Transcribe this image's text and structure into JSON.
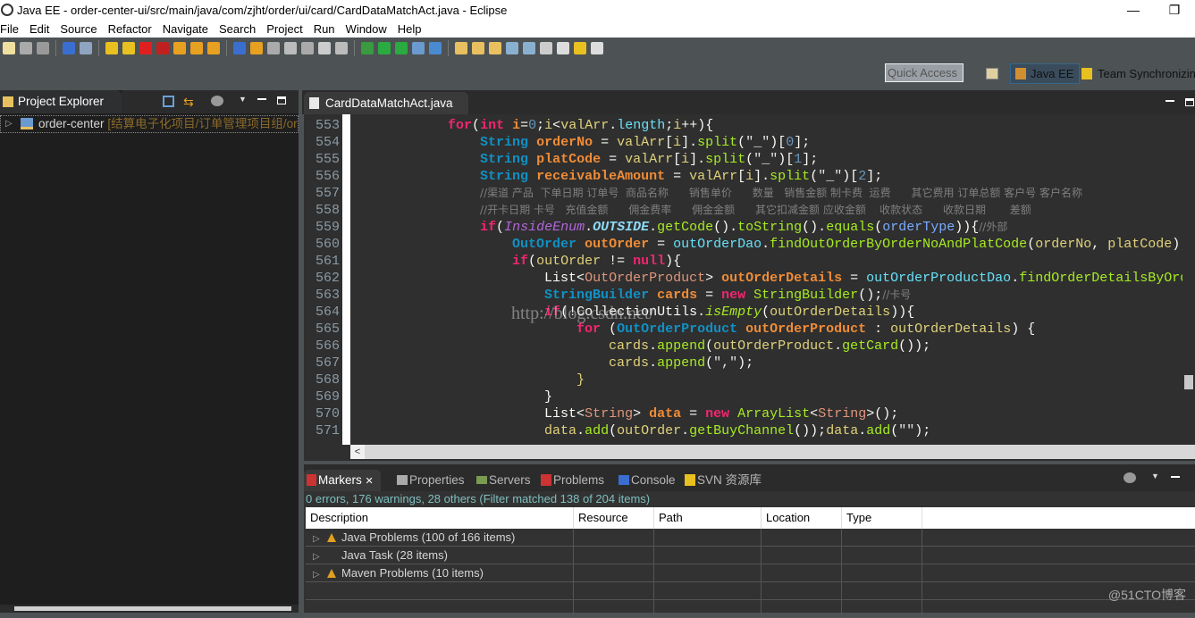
{
  "window": {
    "title": "Java EE - order-center-ui/src/main/java/com/zjht/order/ui/card/CardDataMatchAct.java - Eclipse",
    "minimize": "—",
    "restore": "❐"
  },
  "menu": [
    "File",
    "Edit",
    "Source",
    "Refactor",
    "Navigate",
    "Search",
    "Project",
    "Run",
    "Window",
    "Help"
  ],
  "toolbar": {
    "icons": [
      {
        "name": "new-icon",
        "color": "#f0e0a0"
      },
      {
        "name": "save-icon",
        "color": "#aaaaaa"
      },
      {
        "name": "save-all-icon",
        "color": "#999999"
      },
      {
        "name": "open-console-icon",
        "color": "#3a6fd0"
      },
      {
        "name": "skip-breakpoints-icon",
        "color": "#8fa4c0"
      },
      {
        "name": "resume-icon",
        "color": "#e8c020"
      },
      {
        "name": "suspend-icon",
        "color": "#e8c020"
      },
      {
        "name": "terminate-icon",
        "color": "#e02020"
      },
      {
        "name": "disconnect-icon",
        "color": "#c02020"
      },
      {
        "name": "step-into-icon",
        "color": "#e8a020"
      },
      {
        "name": "step-over-icon",
        "color": "#e8a020"
      },
      {
        "name": "step-return-icon",
        "color": "#e8a020"
      },
      {
        "name": "drop-to-frame-icon",
        "color": "#3a6fd0"
      },
      {
        "name": "use-step-filters-icon",
        "color": "#e8a020"
      },
      {
        "name": "tcp-monitor-icon",
        "color": "#aaaaaa"
      },
      {
        "name": "pen-icon",
        "color": "#bbbbbb"
      },
      {
        "name": "servers-icon",
        "color": "#aaaaaa"
      },
      {
        "name": "show-whitespace-icon",
        "color": "#cccccc"
      },
      {
        "name": "paragraph-icon",
        "color": "#bbbbbb"
      },
      {
        "name": "debug-icon",
        "color": "#3a9a40"
      },
      {
        "name": "run-icon",
        "color": "#2aaa40"
      },
      {
        "name": "run-external-icon",
        "color": "#2aaa40"
      },
      {
        "name": "new-server-icon",
        "color": "#6a9ad0"
      },
      {
        "name": "new-web-service-icon",
        "color": "#4a8ad0"
      },
      {
        "name": "open-folder-icon",
        "color": "#e8c060"
      },
      {
        "name": "open-type-icon",
        "color": "#e8c060"
      },
      {
        "name": "brush-icon",
        "color": "#e8c060"
      },
      {
        "name": "globe-icon",
        "color": "#8ab0d0"
      },
      {
        "name": "search-icon",
        "color": "#8ab0d0"
      },
      {
        "name": "pin-icon",
        "color": "#cccccc"
      },
      {
        "name": "last-edit-icon",
        "color": "#dddddd"
      },
      {
        "name": "back-icon",
        "color": "#e8c020"
      },
      {
        "name": "forward-icon",
        "color": "#dddddd"
      }
    ]
  },
  "quick_access": {
    "placeholder": "Quick Access"
  },
  "perspectives": {
    "active": "Java EE",
    "other": "Team Synchronizing"
  },
  "project_explorer": {
    "tab": "Project Explorer",
    "close": "✕",
    "items": [
      {
        "name": "order-center",
        "decoration": "[结算电子化项目/订单管理项目组/order"
      }
    ]
  },
  "editor": {
    "tab": "CardDataMatchAct.java",
    "close": "✕",
    "watermark": "http://blog.csdn.net/",
    "lines": [
      {
        "n": "553",
        "t": [
          [
            "p",
            "            "
          ],
          [
            "kw",
            "for"
          ],
          [
            "p",
            "("
          ],
          [
            "kw",
            "int"
          ],
          [
            "p",
            " "
          ],
          [
            "dv",
            "i"
          ],
          [
            "p",
            "="
          ],
          [
            "n",
            "0"
          ],
          [
            "p",
            ";"
          ],
          [
            "v",
            "i"
          ],
          [
            "p",
            "<"
          ],
          [
            "v",
            "valArr"
          ],
          [
            "p",
            "."
          ],
          [
            "f",
            "length"
          ],
          [
            "p",
            ";"
          ],
          [
            "v",
            "i"
          ],
          [
            "p",
            "++){"
          ]
        ]
      },
      {
        "n": "554",
        "t": [
          [
            "p",
            "                "
          ],
          [
            "ty",
            "String"
          ],
          [
            "p",
            " "
          ],
          [
            "dv",
            "orderNo"
          ],
          [
            "p",
            " = "
          ],
          [
            "v",
            "valArr"
          ],
          [
            "p",
            "["
          ],
          [
            "v",
            "i"
          ],
          [
            "p",
            "]."
          ],
          [
            "m",
            "split"
          ],
          [
            "p",
            "("
          ],
          [
            "s",
            "\"_\""
          ],
          [
            "p",
            ")["
          ],
          [
            "n",
            "0"
          ],
          [
            "p",
            "];"
          ]
        ]
      },
      {
        "n": "555",
        "t": [
          [
            "p",
            "                "
          ],
          [
            "ty",
            "String"
          ],
          [
            "p",
            " "
          ],
          [
            "dv",
            "platCode"
          ],
          [
            "p",
            " = "
          ],
          [
            "v",
            "valArr"
          ],
          [
            "p",
            "["
          ],
          [
            "v",
            "i"
          ],
          [
            "p",
            "]."
          ],
          [
            "m",
            "split"
          ],
          [
            "p",
            "("
          ],
          [
            "s",
            "\"_\""
          ],
          [
            "p",
            ")["
          ],
          [
            "n",
            "1"
          ],
          [
            "p",
            "];"
          ]
        ]
      },
      {
        "n": "556",
        "t": [
          [
            "p",
            "                "
          ],
          [
            "ty",
            "String"
          ],
          [
            "p",
            " "
          ],
          [
            "dv",
            "receivableAmount"
          ],
          [
            "p",
            " = "
          ],
          [
            "v",
            "valArr"
          ],
          [
            "p",
            "["
          ],
          [
            "v",
            "i"
          ],
          [
            "p",
            "]."
          ],
          [
            "m",
            "split"
          ],
          [
            "p",
            "("
          ],
          [
            "s",
            "\"_\""
          ],
          [
            "p",
            ")["
          ],
          [
            "n",
            "2"
          ],
          [
            "p",
            "];"
          ]
        ]
      },
      {
        "n": "557",
        "t": [
          [
            "p",
            "                "
          ],
          [
            "cm",
            "//渠道 产品  下单日期 订单号  商品名称      销售单价      数量   销售金额 制卡费  运费      其它费用 订单总额 客户号 客户名称"
          ]
        ]
      },
      {
        "n": "558",
        "t": [
          [
            "p",
            "                "
          ],
          [
            "cm",
            "//开卡日期 卡号   充值金额      佣金费率      佣金金额      其它扣减金额 应收金额    收款状态      收款日期       差额"
          ]
        ]
      },
      {
        "n": "559",
        "t": [
          [
            "p",
            "                "
          ],
          [
            "kw",
            "if"
          ],
          [
            "p",
            "("
          ],
          [
            "en",
            "InsideEnum"
          ],
          [
            "p",
            "."
          ],
          [
            "ec",
            "OUTSIDE"
          ],
          [
            "p",
            "."
          ],
          [
            "m",
            "getCode"
          ],
          [
            "p",
            "()."
          ],
          [
            "m",
            "toString"
          ],
          [
            "p",
            "()."
          ],
          [
            "m",
            "equals"
          ],
          [
            "p",
            "("
          ],
          [
            "pa",
            "orderType"
          ],
          [
            "p",
            ")){"
          ],
          [
            "cm",
            "//外部"
          ]
        ]
      },
      {
        "n": "560",
        "t": [
          [
            "p",
            "                    "
          ],
          [
            "ty",
            "OutOrder"
          ],
          [
            "p",
            " "
          ],
          [
            "dv",
            "outOrder"
          ],
          [
            "p",
            " = "
          ],
          [
            "f",
            "outOrderDao"
          ],
          [
            "p",
            "."
          ],
          [
            "m",
            "findOutOrderByOrderNoAndPlatCode"
          ],
          [
            "p",
            "("
          ],
          [
            "v",
            "orderNo"
          ],
          [
            "p",
            ", "
          ],
          [
            "v",
            "platCode"
          ],
          [
            "p",
            ");"
          ]
        ]
      },
      {
        "n": "561",
        "t": [
          [
            "p",
            "                    "
          ],
          [
            "kw",
            "if"
          ],
          [
            "p",
            "("
          ],
          [
            "v",
            "outOrder"
          ],
          [
            "p",
            " != "
          ],
          [
            "kw",
            "null"
          ],
          [
            "p",
            "){"
          ]
        ]
      },
      {
        "n": "562",
        "t": [
          [
            "p",
            "                        "
          ],
          [
            "p",
            "List<"
          ],
          [
            "ga",
            "OutOrderProduct"
          ],
          [
            "p",
            "> "
          ],
          [
            "dv",
            "outOrderDetails"
          ],
          [
            "p",
            " = "
          ],
          [
            "f",
            "outOrderProductDao"
          ],
          [
            "p",
            "."
          ],
          [
            "m",
            "findOrderDetailsByOrderNo"
          ],
          [
            "p",
            "("
          ]
        ]
      },
      {
        "n": "563",
        "t": [
          [
            "p",
            "                        "
          ],
          [
            "ty",
            "StringBuilder"
          ],
          [
            "p",
            " "
          ],
          [
            "dv",
            "cards"
          ],
          [
            "p",
            " = "
          ],
          [
            "kw",
            "new"
          ],
          [
            "p",
            " "
          ],
          [
            "m",
            "StringBuilder"
          ],
          [
            "p",
            "();"
          ],
          [
            "cm",
            "//卡号"
          ]
        ]
      },
      {
        "n": "564",
        "t": [
          [
            "p",
            "                        "
          ],
          [
            "kw",
            "if"
          ],
          [
            "p",
            "(!"
          ],
          [
            "p",
            "CollectionUtils"
          ],
          [
            "p",
            "."
          ],
          [
            "sm",
            "isEmpty"
          ],
          [
            "p",
            "("
          ],
          [
            "v",
            "outOrderDetails"
          ],
          [
            "p",
            ")){"
          ]
        ]
      },
      {
        "n": "565",
        "t": [
          [
            "p",
            "                            "
          ],
          [
            "kw",
            "for"
          ],
          [
            "p",
            " ("
          ],
          [
            "ty",
            "OutOrderProduct"
          ],
          [
            "p",
            " "
          ],
          [
            "dv",
            "outOrderProduct"
          ],
          [
            "p",
            " : "
          ],
          [
            "v",
            "outOrderDetails"
          ],
          [
            "p",
            ") {"
          ]
        ]
      },
      {
        "n": "566",
        "t": [
          [
            "p",
            "                                "
          ],
          [
            "v",
            "cards"
          ],
          [
            "p",
            "."
          ],
          [
            "m",
            "append"
          ],
          [
            "p",
            "("
          ],
          [
            "v",
            "outOrderProduct"
          ],
          [
            "p",
            "."
          ],
          [
            "m",
            "getCard"
          ],
          [
            "p",
            "());"
          ]
        ]
      },
      {
        "n": "567",
        "t": [
          [
            "p",
            "                                "
          ],
          [
            "v",
            "cards"
          ],
          [
            "p",
            "."
          ],
          [
            "m",
            "append"
          ],
          [
            "p",
            "("
          ],
          [
            "s",
            "\",\""
          ],
          [
            "p",
            ");"
          ]
        ]
      },
      {
        "n": "568",
        "t": [
          [
            "p",
            "                            "
          ],
          [
            "v",
            "}"
          ]
        ]
      },
      {
        "n": "569",
        "t": [
          [
            "p",
            "                        "
          ],
          [
            "p",
            "}"
          ]
        ]
      },
      {
        "n": "570",
        "t": [
          [
            "p",
            "                        "
          ],
          [
            "p",
            "List<"
          ],
          [
            "ga",
            "String"
          ],
          [
            "p",
            "> "
          ],
          [
            "dv",
            "data"
          ],
          [
            "p",
            " = "
          ],
          [
            "kw",
            "new"
          ],
          [
            "p",
            " "
          ],
          [
            "m",
            "ArrayList"
          ],
          [
            "p",
            "<"
          ],
          [
            "ga",
            "String"
          ],
          [
            "p",
            ">();"
          ]
        ]
      },
      {
        "n": "571",
        "t": [
          [
            "p",
            "                        "
          ],
          [
            "v",
            "data"
          ],
          [
            "p",
            "."
          ],
          [
            "m",
            "add"
          ],
          [
            "p",
            "("
          ],
          [
            "v",
            "outOrder"
          ],
          [
            "p",
            "."
          ],
          [
            "m",
            "getBuyChannel"
          ],
          [
            "p",
            "());"
          ],
          [
            "v",
            "data"
          ],
          [
            "p",
            "."
          ],
          [
            "m",
            "add"
          ],
          [
            "p",
            "("
          ],
          [
            "s",
            "\"\""
          ],
          [
            "p",
            ");"
          ]
        ]
      }
    ]
  },
  "bottom_panel": {
    "tabs": [
      {
        "label": "Markers",
        "close": "✕"
      },
      {
        "label": "Properties"
      },
      {
        "label": "Servers"
      },
      {
        "label": "Problems"
      },
      {
        "label": "Console"
      },
      {
        "label": "SVN 资源库"
      }
    ],
    "status": "0 errors, 176 warnings, 28 others (Filter matched 138 of 204 items)",
    "columns": [
      "Description",
      "Resource",
      "Path",
      "Location",
      "Type"
    ],
    "rows": [
      {
        "label": "Java Problems (100 of 166 items)",
        "icon": "warning-icon"
      },
      {
        "label": "Java Task (28 items)",
        "icon": ""
      },
      {
        "label": "Maven Problems (10 items)",
        "icon": "warning-icon"
      }
    ]
  },
  "watermark": "@51CTO博客"
}
